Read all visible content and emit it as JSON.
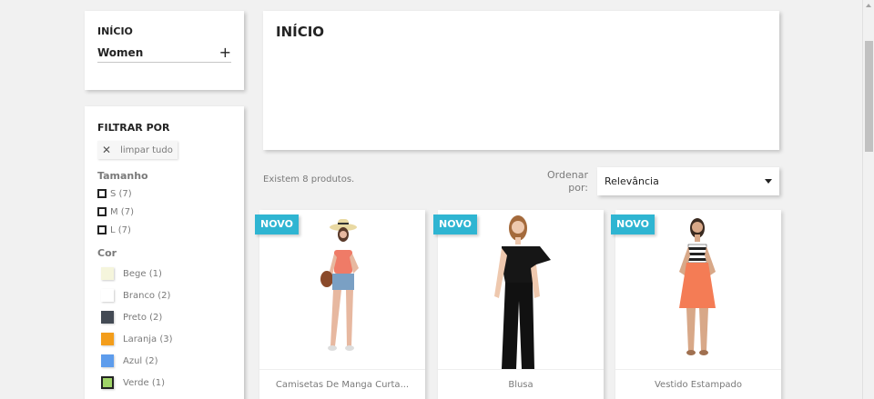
{
  "category_block": {
    "title": "INÍCIO",
    "item": "Women",
    "expand_symbol": "+"
  },
  "filters": {
    "title": "FILTRAR POR",
    "clear_all": "limpar tudo",
    "size": {
      "title": "Tamanho",
      "items": [
        "S (7)",
        "M (7)",
        "L (7)"
      ]
    },
    "color": {
      "title": "Cor",
      "items": [
        {
          "label": "Bege (1)",
          "color": "#f5f5dc"
        },
        {
          "label": "Branco (2)",
          "color": "#ffffff"
        },
        {
          "label": "Preto (2)",
          "color": "#434a54"
        },
        {
          "label": "Laranja (3)",
          "color": "#f39d1b"
        },
        {
          "label": "Azul (2)",
          "color": "#5d9cec"
        },
        {
          "label": "Verde (1)",
          "color": "#a0d468"
        }
      ]
    }
  },
  "header": {
    "title": "INÍCIO"
  },
  "sort": {
    "count_text": "Existem 8 produtos.",
    "label": "Ordenar por:",
    "selected": "Relevância"
  },
  "products": [
    {
      "badge": "NOVO",
      "name": "Camisetas De Manga Curta..."
    },
    {
      "badge": "NOVO",
      "name": "Blusa"
    },
    {
      "badge": "NOVO",
      "name": "Vestido Estampado"
    }
  ],
  "colors": {
    "accent": "#2fb5d2",
    "background": "#f1f1f1"
  }
}
